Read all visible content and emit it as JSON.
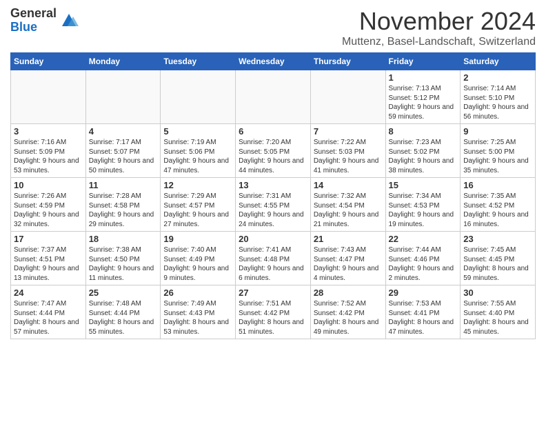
{
  "logo": {
    "general": "General",
    "blue": "Blue"
  },
  "title": "November 2024",
  "location": "Muttenz, Basel-Landschaft, Switzerland",
  "days_of_week": [
    "Sunday",
    "Monday",
    "Tuesday",
    "Wednesday",
    "Thursday",
    "Friday",
    "Saturday"
  ],
  "weeks": [
    [
      {
        "day": "",
        "info": ""
      },
      {
        "day": "",
        "info": ""
      },
      {
        "day": "",
        "info": ""
      },
      {
        "day": "",
        "info": ""
      },
      {
        "day": "",
        "info": ""
      },
      {
        "day": "1",
        "info": "Sunrise: 7:13 AM\nSunset: 5:12 PM\nDaylight: 9 hours and 59 minutes."
      },
      {
        "day": "2",
        "info": "Sunrise: 7:14 AM\nSunset: 5:10 PM\nDaylight: 9 hours and 56 minutes."
      }
    ],
    [
      {
        "day": "3",
        "info": "Sunrise: 7:16 AM\nSunset: 5:09 PM\nDaylight: 9 hours and 53 minutes."
      },
      {
        "day": "4",
        "info": "Sunrise: 7:17 AM\nSunset: 5:07 PM\nDaylight: 9 hours and 50 minutes."
      },
      {
        "day": "5",
        "info": "Sunrise: 7:19 AM\nSunset: 5:06 PM\nDaylight: 9 hours and 47 minutes."
      },
      {
        "day": "6",
        "info": "Sunrise: 7:20 AM\nSunset: 5:05 PM\nDaylight: 9 hours and 44 minutes."
      },
      {
        "day": "7",
        "info": "Sunrise: 7:22 AM\nSunset: 5:03 PM\nDaylight: 9 hours and 41 minutes."
      },
      {
        "day": "8",
        "info": "Sunrise: 7:23 AM\nSunset: 5:02 PM\nDaylight: 9 hours and 38 minutes."
      },
      {
        "day": "9",
        "info": "Sunrise: 7:25 AM\nSunset: 5:00 PM\nDaylight: 9 hours and 35 minutes."
      }
    ],
    [
      {
        "day": "10",
        "info": "Sunrise: 7:26 AM\nSunset: 4:59 PM\nDaylight: 9 hours and 32 minutes."
      },
      {
        "day": "11",
        "info": "Sunrise: 7:28 AM\nSunset: 4:58 PM\nDaylight: 9 hours and 29 minutes."
      },
      {
        "day": "12",
        "info": "Sunrise: 7:29 AM\nSunset: 4:57 PM\nDaylight: 9 hours and 27 minutes."
      },
      {
        "day": "13",
        "info": "Sunrise: 7:31 AM\nSunset: 4:55 PM\nDaylight: 9 hours and 24 minutes."
      },
      {
        "day": "14",
        "info": "Sunrise: 7:32 AM\nSunset: 4:54 PM\nDaylight: 9 hours and 21 minutes."
      },
      {
        "day": "15",
        "info": "Sunrise: 7:34 AM\nSunset: 4:53 PM\nDaylight: 9 hours and 19 minutes."
      },
      {
        "day": "16",
        "info": "Sunrise: 7:35 AM\nSunset: 4:52 PM\nDaylight: 9 hours and 16 minutes."
      }
    ],
    [
      {
        "day": "17",
        "info": "Sunrise: 7:37 AM\nSunset: 4:51 PM\nDaylight: 9 hours and 13 minutes."
      },
      {
        "day": "18",
        "info": "Sunrise: 7:38 AM\nSunset: 4:50 PM\nDaylight: 9 hours and 11 minutes."
      },
      {
        "day": "19",
        "info": "Sunrise: 7:40 AM\nSunset: 4:49 PM\nDaylight: 9 hours and 9 minutes."
      },
      {
        "day": "20",
        "info": "Sunrise: 7:41 AM\nSunset: 4:48 PM\nDaylight: 9 hours and 6 minutes."
      },
      {
        "day": "21",
        "info": "Sunrise: 7:43 AM\nSunset: 4:47 PM\nDaylight: 9 hours and 4 minutes."
      },
      {
        "day": "22",
        "info": "Sunrise: 7:44 AM\nSunset: 4:46 PM\nDaylight: 9 hours and 2 minutes."
      },
      {
        "day": "23",
        "info": "Sunrise: 7:45 AM\nSunset: 4:45 PM\nDaylight: 8 hours and 59 minutes."
      }
    ],
    [
      {
        "day": "24",
        "info": "Sunrise: 7:47 AM\nSunset: 4:44 PM\nDaylight: 8 hours and 57 minutes."
      },
      {
        "day": "25",
        "info": "Sunrise: 7:48 AM\nSunset: 4:44 PM\nDaylight: 8 hours and 55 minutes."
      },
      {
        "day": "26",
        "info": "Sunrise: 7:49 AM\nSunset: 4:43 PM\nDaylight: 8 hours and 53 minutes."
      },
      {
        "day": "27",
        "info": "Sunrise: 7:51 AM\nSunset: 4:42 PM\nDaylight: 8 hours and 51 minutes."
      },
      {
        "day": "28",
        "info": "Sunrise: 7:52 AM\nSunset: 4:42 PM\nDaylight: 8 hours and 49 minutes."
      },
      {
        "day": "29",
        "info": "Sunrise: 7:53 AM\nSunset: 4:41 PM\nDaylight: 8 hours and 47 minutes."
      },
      {
        "day": "30",
        "info": "Sunrise: 7:55 AM\nSunset: 4:40 PM\nDaylight: 8 hours and 45 minutes."
      }
    ]
  ]
}
